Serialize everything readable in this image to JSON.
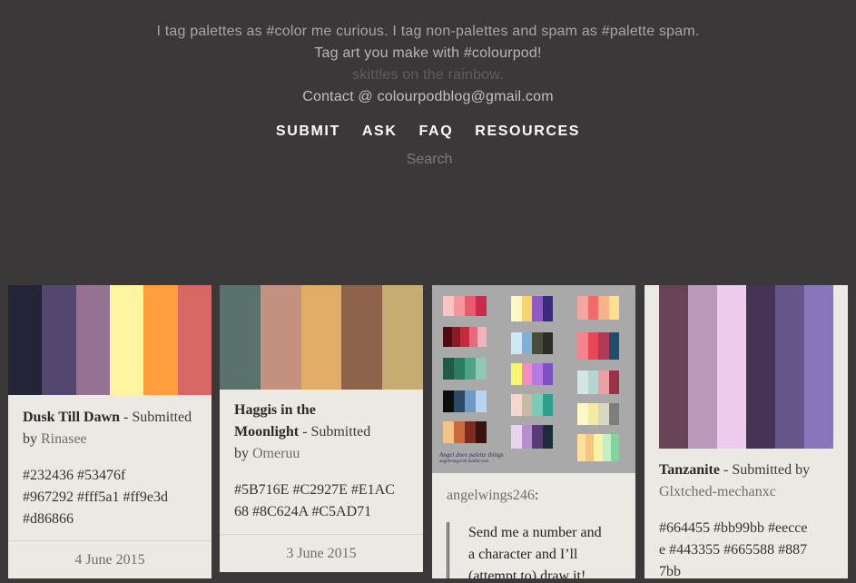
{
  "header": {
    "line1": "I tag palettes as #color me curious. I tag non-palettes and spam as #palette spam.",
    "line2": "Tag art you make with #colourpod!",
    "line3": "skittles on the rainbow.",
    "line4": "Contact @ colourpodblog@gmail.com"
  },
  "nav": {
    "submit": "SUBMIT",
    "ask": "ASK",
    "faq": "FAQ",
    "resources": "RESOURCES"
  },
  "search": {
    "placeholder": "Search"
  },
  "posts": [
    {
      "title": "Dusk Till Dawn",
      "submitted": " - Submitted by ",
      "author": "Rinasee",
      "codes_line1": "#232436 #53476f",
      "codes_line2": "#967292 #fff5a1 #ff9e3d",
      "codes_line3": "#d86866",
      "date": "4 June 2015",
      "colors": [
        "#232436",
        "#53476f",
        "#967292",
        "#fff5a1",
        "#ff9e3d",
        "#d86866"
      ]
    },
    {
      "title_line1": "Haggis in the",
      "title_line2": "Moonlight",
      "submitted": " - Submitted",
      "by": "by ",
      "author": "Omeruu",
      "codes_line1": "#5B716E #C2927E #E1AC",
      "codes_line2": "68 #8C624A #C5AD71",
      "date": "3 June 2015",
      "colors": [
        "#5B716E",
        "#C2927E",
        "#E1AC68",
        "#8C624A",
        "#C5AD71"
      ]
    },
    {
      "author": "angelwings246",
      "colon": ":",
      "image_caption_1": "Angel does palette things",
      "image_caption_2": "angelwings246.tumblr.com",
      "quote_line1": "Send me a number and",
      "quote_line2": "a character and I’ll",
      "quote_line3": "(attempt to) draw it!"
    },
    {
      "title": "Tanzanite",
      "submitted": " - Submitted by",
      "author": "Glxtched-mechanxc",
      "codes_line1": "#664455  #bb99bb  #eecce",
      "codes_line2": "e #443355  #665588  #887",
      "codes_line3": "7bb",
      "colors": [
        "#664455",
        "#bb99bb",
        "#eeccee",
        "#443355",
        "#665588",
        "#8877bb"
      ]
    }
  ]
}
